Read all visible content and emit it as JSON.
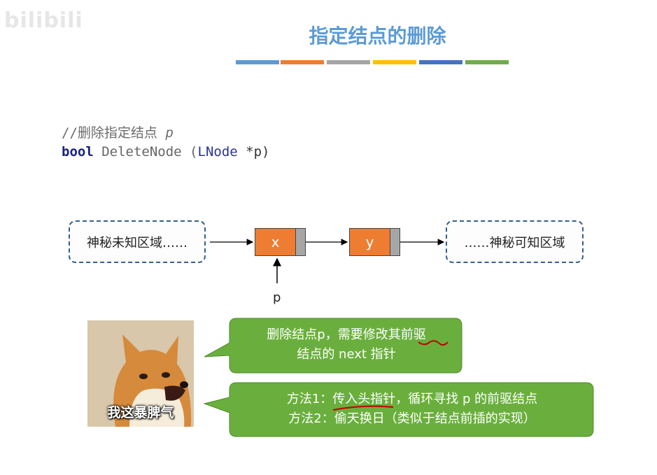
{
  "watermark": {
    "logo_text": "bilibili"
  },
  "slide": {
    "title": "指定结点的删除",
    "color_bar": [
      "#5b9bd5",
      "#ed7d31",
      "#a5a5a5",
      "#ffc000",
      "#4472c4",
      "#70ad47"
    ]
  },
  "code": {
    "comment_prefix": "//删除指定结点 ",
    "comment_var": "p",
    "keyword": "bool",
    "function": "DeleteNode",
    "open_paren": " (",
    "param_type": "LNode",
    "param_rest": " *p)"
  },
  "diagram": {
    "left_region": "神秘未知区域……",
    "right_region": "……神秘可知区域",
    "node_x": "x",
    "node_y": "y",
    "pointer_label": "p"
  },
  "meme": {
    "caption": "我这暴脾气"
  },
  "bubbles": {
    "top": {
      "line1": "删除结点p，需要修改其前驱",
      "line2": "结点的 next 指针"
    },
    "bottom": {
      "line1": "方法1：传入头指针，循环寻找 p 的前驱结点",
      "line2": "方法2：偷天换日（类似于结点前插的实现）"
    }
  },
  "colors": {
    "title": "#5b9bd5",
    "node_fill": "#ee7d31",
    "pointer_fill": "#a6a6a6",
    "bubble_fill": "#6aaf3d",
    "annotation_red": "#c00000",
    "dashed_border": "#34608c"
  }
}
